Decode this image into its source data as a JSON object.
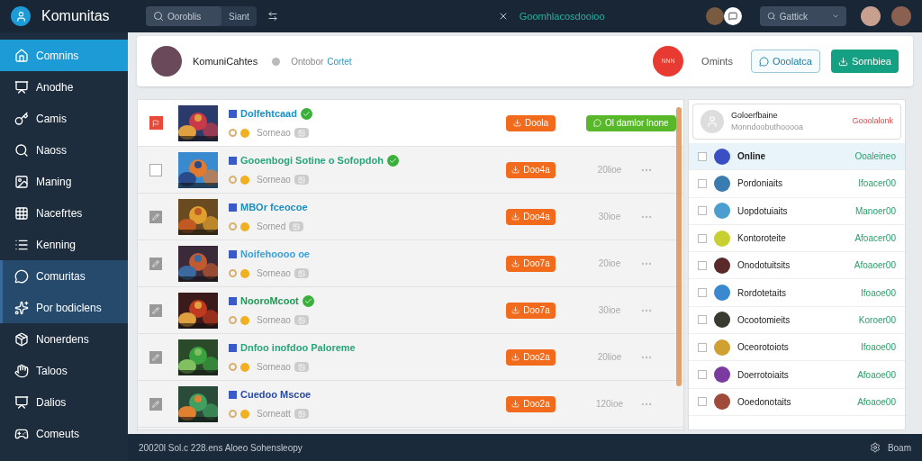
{
  "topbar": {
    "logo": "Komunitas",
    "search": {
      "placeholder": "Ooroblis"
    },
    "search_tab": "Siant",
    "breadcrumb": "Goomhlacosdooioo",
    "search2": {
      "placeholder": "Gattick"
    }
  },
  "sidebar": {
    "items": [
      {
        "label": "Comnins",
        "selected": true,
        "group": false
      },
      {
        "label": "Anodhe",
        "selected": false,
        "group": false
      },
      {
        "label": "Camis",
        "selected": false,
        "group": false
      },
      {
        "label": "Naoss",
        "selected": false,
        "group": false
      },
      {
        "label": "Maning",
        "selected": false,
        "group": false
      },
      {
        "label": "Nacefrtes",
        "selected": false,
        "group": false
      },
      {
        "label": "Kenning",
        "selected": false,
        "group": false
      },
      {
        "label": "Comuritas",
        "selected": false,
        "group": true
      },
      {
        "label": "Por bodiclens",
        "selected": false,
        "group": true
      },
      {
        "label": "Nonerdens",
        "selected": false,
        "group": false
      },
      {
        "label": "Taloos",
        "selected": false,
        "group": false
      },
      {
        "label": "Dalios",
        "selected": false,
        "group": false
      },
      {
        "label": "Comeuts",
        "selected": false,
        "group": false
      }
    ]
  },
  "profile": {
    "name": "KomuniCahtes",
    "status": "Ontobor",
    "link": "Cortet",
    "badge": "NNN",
    "count_label": "Omints",
    "outline_button": "Ooolatca",
    "primary_button": "Sornbiea"
  },
  "rows": [
    {
      "kind": "button",
      "checked": true,
      "disabled": false,
      "selected": true,
      "title": "Dolfehtcaad",
      "color": "#1a8fc4",
      "verified": true,
      "tag": "Sorneao",
      "action": "Doola",
      "extra": "Ol damlor lnone"
    },
    {
      "kind": "count",
      "checked": false,
      "disabled": false,
      "selected": false,
      "title": "Gooenbogi Sotine o Sofopdoh",
      "color": "#2aa57a",
      "verified": true,
      "tag": "Sorneao",
      "action": "Doo4a",
      "extra": "20lioe"
    },
    {
      "kind": "count",
      "checked": false,
      "disabled": true,
      "selected": false,
      "title": "MBOr fceocoe",
      "color": "#1a8fc4",
      "verified": false,
      "tag": "Sorned",
      "action": "Doo4a",
      "extra": "30ioe"
    },
    {
      "kind": "count",
      "checked": false,
      "disabled": true,
      "selected": false,
      "title": "Noifehoooo oe",
      "color": "#3aa0d8",
      "verified": false,
      "tag": "Sorneao",
      "action": "Doo7a",
      "extra": "20ioe"
    },
    {
      "kind": "count",
      "checked": false,
      "disabled": true,
      "selected": false,
      "title": "NooroMcoot",
      "color": "#1f9a55",
      "verified": true,
      "tag": "Sorneao",
      "action": "Doo7a",
      "extra": "30ioe"
    },
    {
      "kind": "count",
      "checked": false,
      "disabled": true,
      "selected": false,
      "title": "Dnfoo inofdoo Paloreme",
      "color": "#2aa57a",
      "verified": false,
      "tag": "Sorneao",
      "action": "Doo2a",
      "extra": "20lioe"
    },
    {
      "kind": "count",
      "checked": false,
      "disabled": true,
      "selected": false,
      "title": "Cuedoo Mscoe",
      "color": "#2a4aa0",
      "verified": false,
      "tag": "Sorneatt",
      "action": "Doo2a",
      "extra": "120ioe"
    }
  ],
  "side_panel": {
    "title": "Goloerfbaine",
    "subtitle": "Monndoobuthooooa",
    "action": "Gooolalonk",
    "members": [
      {
        "name": "Online",
        "status": "Ooaleineo",
        "selected": true,
        "checked": false,
        "color": "#3b4fc4"
      },
      {
        "name": "Pordoniaits",
        "status": "Ifoacer00",
        "selected": false,
        "checked": false,
        "color": "#3a7bb0"
      },
      {
        "name": "Uopdotuiaits",
        "status": "Manoer00",
        "selected": false,
        "checked": false,
        "color": "#4a9fd0"
      },
      {
        "name": "Kontoroteite",
        "status": "Afoacer00",
        "selected": false,
        "checked": false,
        "color": "#c8d030"
      },
      {
        "name": "Onodotuitsits",
        "status": "Afoaoer00",
        "selected": false,
        "checked": false,
        "color": "#5a2a2a"
      },
      {
        "name": "Rordotetaits",
        "status": "Ifoaoe00",
        "selected": false,
        "checked": false,
        "color": "#3a88d0"
      },
      {
        "name": "Ocootomieits",
        "status": "Koroer00",
        "selected": false,
        "checked": false,
        "color": "#3a3a30"
      },
      {
        "name": "Oceorotoiots",
        "status": "Ifoaoe00",
        "selected": false,
        "checked": false,
        "color": "#d0a030"
      },
      {
        "name": "Doerrotoiaits",
        "status": "Afoaoe00",
        "selected": false,
        "checked": false,
        "color": "#7a3aa0"
      },
      {
        "name": "Ooedonotaits",
        "status": "Afoaoe00",
        "selected": false,
        "checked": false,
        "color": "#a04a3a"
      }
    ]
  },
  "footer": {
    "text": "20020l Sol.c 228.ens Aloeo Sohensleopy",
    "right": "Boam"
  }
}
